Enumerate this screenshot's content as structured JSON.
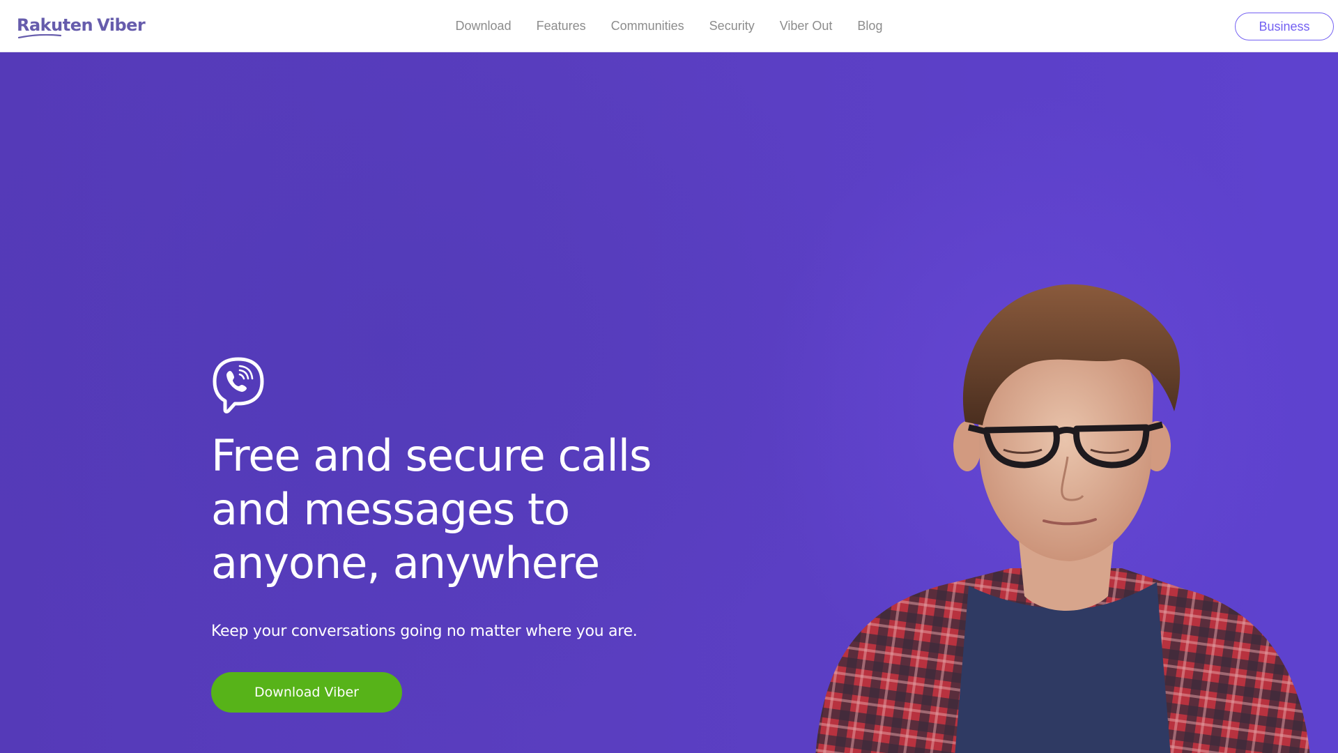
{
  "header": {
    "logo": {
      "brand": "Rakuten",
      "product": "Viber"
    },
    "nav": [
      {
        "label": "Download"
      },
      {
        "label": "Features"
      },
      {
        "label": "Communities"
      },
      {
        "label": "Security"
      },
      {
        "label": "Viber Out"
      },
      {
        "label": "Blog"
      }
    ],
    "business_label": "Business"
  },
  "hero": {
    "headline_lines": [
      "Free and secure calls",
      "and messages to",
      "anyone, anywhere"
    ],
    "subtext": "Keep your conversations going no matter where you are.",
    "cta_label": "Download Viber",
    "icons": {
      "app": "viber-phone-bubble-icon"
    }
  },
  "colors": {
    "brand_purple": "#665cac",
    "accent_purple": "#7360f2",
    "hero_background": "#5a3ec0",
    "cta_green": "#57b319",
    "nav_text": "#8c8c8c"
  }
}
